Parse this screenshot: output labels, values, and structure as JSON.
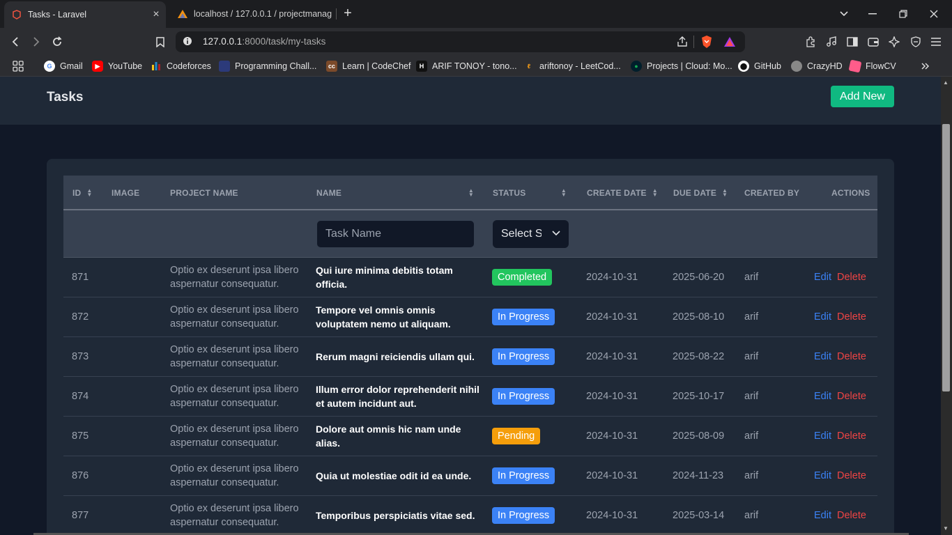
{
  "browser": {
    "tabs": [
      {
        "label": "Tasks - Laravel",
        "icon": "laravel-icon",
        "active": true
      },
      {
        "label": "localhost / 127.0.0.1 / projectmanag",
        "icon": "phpmyadmin-icon",
        "active": false
      }
    ],
    "url_host": "127.0.0.1",
    "url_path": ":8000/task/my-tasks",
    "bookmarks": [
      {
        "label": "Gmail",
        "icon": "google-icon",
        "color": "#ffffff"
      },
      {
        "label": "YouTube",
        "icon": "youtube-icon",
        "color": "#ff0000"
      },
      {
        "label": "Codeforces",
        "icon": "codeforces-icon",
        "color": "#f5c518"
      },
      {
        "label": "Programming Chall...",
        "icon": "programming-icon",
        "color": "#2c3a7a"
      },
      {
        "label": "Learn | CodeChef",
        "icon": "codechef-icon",
        "color": "#7b4a2a"
      },
      {
        "label": "ARIF TONOY - tono...",
        "icon": "hackerrank-icon",
        "color": "#1ba94c"
      },
      {
        "label": "ariftonoy - LeetCod...",
        "icon": "leetcode-icon",
        "color": "#ffa116"
      },
      {
        "label": "Projects | Cloud: Mo...",
        "icon": "mongodb-icon",
        "color": "#13aa52"
      },
      {
        "label": "GitHub",
        "icon": "github-icon",
        "color": "#ffffff"
      },
      {
        "label": "CrazyHD",
        "icon": "crazyhd-icon",
        "color": "#888888"
      },
      {
        "label": "FlowCV",
        "icon": "flowcv-icon",
        "color": "#ff5c8a"
      }
    ]
  },
  "header": {
    "title": "Tasks",
    "add_button": "Add New"
  },
  "table": {
    "columns": {
      "id": "ID",
      "image": "IMAGE",
      "project_name": "PROJECT NAME",
      "name": "NAME",
      "status": "STATUS",
      "create_date": "CREATE DATE",
      "due_date": "DUE DATE",
      "created_by": "CREATED BY",
      "actions": "ACTIONS"
    },
    "filters": {
      "name_placeholder": "Task Name",
      "status_selected": "Select Status"
    },
    "edit_label": "Edit",
    "delete_label": "Delete",
    "rows": [
      {
        "id": "871",
        "project": "Optio ex deserunt ipsa libero aspernatur consequatur.",
        "name": "Qui iure minima debitis totam officia.",
        "status": "Completed",
        "status_color": "#22c55e",
        "create_date": "2024-10-31",
        "due_date": "2025-06-20",
        "created_by": "arif"
      },
      {
        "id": "872",
        "project": "Optio ex deserunt ipsa libero aspernatur consequatur.",
        "name": "Tempore vel omnis omnis voluptatem nemo ut aliquam.",
        "status": "In Progress",
        "status_color": "#3b82f6",
        "create_date": "2024-10-31",
        "due_date": "2025-08-10",
        "created_by": "arif"
      },
      {
        "id": "873",
        "project": "Optio ex deserunt ipsa libero aspernatur consequatur.",
        "name": "Rerum magni reiciendis ullam qui.",
        "status": "In Progress",
        "status_color": "#3b82f6",
        "create_date": "2024-10-31",
        "due_date": "2025-08-22",
        "created_by": "arif"
      },
      {
        "id": "874",
        "project": "Optio ex deserunt ipsa libero aspernatur consequatur.",
        "name": "Illum error dolor reprehenderit nihil et autem incidunt aut.",
        "status": "In Progress",
        "status_color": "#3b82f6",
        "create_date": "2024-10-31",
        "due_date": "2025-10-17",
        "created_by": "arif"
      },
      {
        "id": "875",
        "project": "Optio ex deserunt ipsa libero aspernatur consequatur.",
        "name": "Dolore aut omnis hic nam unde alias.",
        "status": "Pending",
        "status_color": "#f59e0b",
        "create_date": "2024-10-31",
        "due_date": "2025-08-09",
        "created_by": "arif"
      },
      {
        "id": "876",
        "project": "Optio ex deserunt ipsa libero aspernatur consequatur.",
        "name": "Quia ut molestiae odit id ea unde.",
        "status": "In Progress",
        "status_color": "#3b82f6",
        "create_date": "2024-10-31",
        "due_date": "2024-11-23",
        "created_by": "arif"
      },
      {
        "id": "877",
        "project": "Optio ex deserunt ipsa libero aspernatur consequatur.",
        "name": "Temporibus perspiciatis vitae sed.",
        "status": "In Progress",
        "status_color": "#3b82f6",
        "create_date": "2024-10-31",
        "due_date": "2025-03-14",
        "created_by": "arif"
      }
    ]
  }
}
